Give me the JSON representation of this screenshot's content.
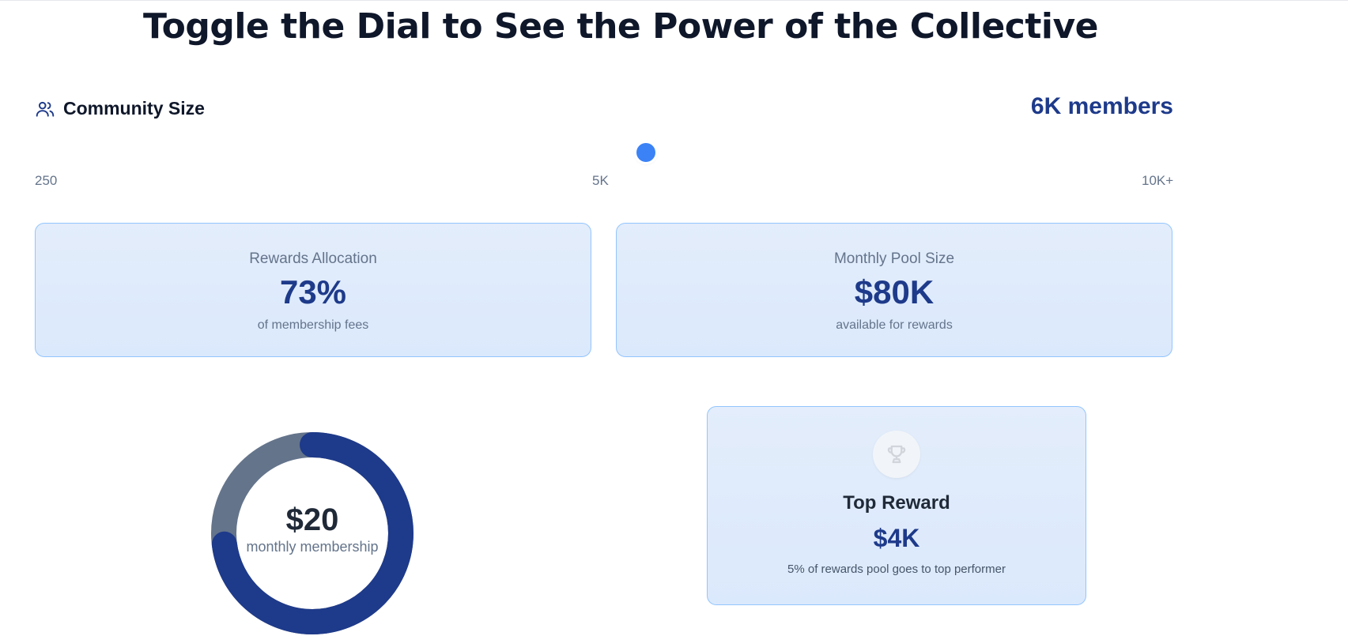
{
  "page": {
    "title": "Toggle the Dial to See the Power of the Collective"
  },
  "community": {
    "label": "Community Size",
    "value_text": "6K members",
    "slider": {
      "min_label": "250",
      "mid_label": "5K",
      "max_label": "10K+",
      "value": 6000
    }
  },
  "stats": {
    "rewards_allocation": {
      "label": "Rewards Allocation",
      "value": "73%",
      "sub": "of membership fees"
    },
    "monthly_pool": {
      "label": "Monthly Pool Size",
      "value": "$80K",
      "sub": "available for rewards"
    }
  },
  "membership": {
    "price": "$20",
    "caption": "monthly membership",
    "donut_fill_fraction": 0.73,
    "colors": {
      "primary": "#1e3a8a",
      "secondary": "#64748b"
    }
  },
  "top_reward": {
    "icon": "trophy-icon",
    "title": "Top Reward",
    "value": "$4K",
    "sub": "5% of rewards pool goes to top performer"
  },
  "colors": {
    "accent": "#3b82f6",
    "brand": "#1e3a8a",
    "card_border": "#93c5fd"
  }
}
